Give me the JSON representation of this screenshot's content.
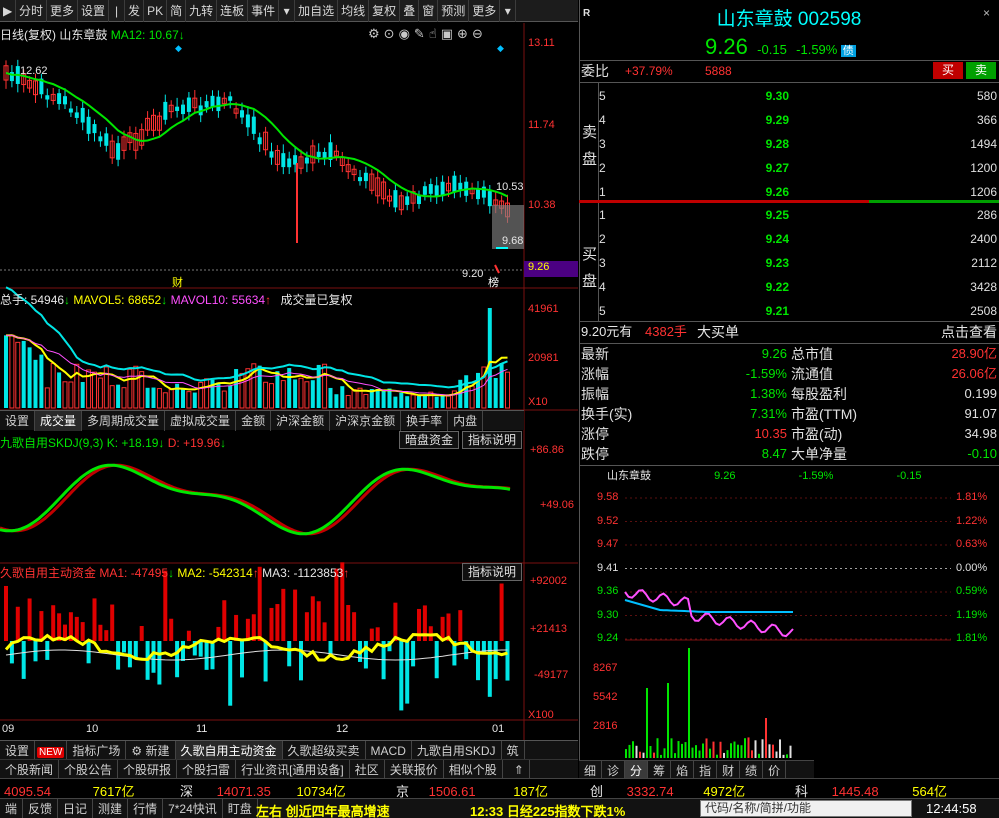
{
  "toolbar": [
    "分时",
    "更多",
    "设置",
    "发",
    "PK",
    "简",
    "九转",
    "连板",
    "事件",
    "加自选",
    "均线",
    "复权",
    "叠",
    "窗",
    "预测",
    "更多"
  ],
  "kline": {
    "title": "日线(复权)",
    "name": "山东章鼓",
    "ma_label": "MA12: 10.67",
    "axis": [
      "13.11",
      "11.74",
      "10.38",
      "9.26"
    ],
    "price_marks": [
      "12.62",
      "10.53",
      "9.68",
      "9.20"
    ],
    "tags": [
      "财",
      "榜"
    ]
  },
  "volume": {
    "label_total": "总手: 54946",
    "label_ma5": "MAVOL5: 68652",
    "label_ma10": "MAVOL10: 55634",
    "label_note": "成交量已复权",
    "axis": [
      "41961",
      "20981",
      "X10"
    ]
  },
  "mid_tabs": [
    "设置",
    "成交量",
    "多周期成交量",
    "虚拟成交量",
    "金额",
    "沪深金额",
    "沪深京金额",
    "换手率",
    "内盘"
  ],
  "skdj": {
    "label": "九歌自用SKDJ(9,3)",
    "k": "K: +18.19",
    "d": "D: +19.96",
    "btn1": "暗盘资金",
    "btn2": "指标说明",
    "axis": [
      "+86.86",
      "+49.06"
    ]
  },
  "fund": {
    "label": "久歌自用主动资金",
    "ma1": "MA1: -47495",
    "ma2": "MA2: -542314",
    "ma3": "MA3: -1123853",
    "btn": "指标说明",
    "axis": [
      "+92002",
      "+21413",
      "-49177",
      "X100"
    ],
    "months": [
      "09",
      "10",
      "11",
      "12",
      "01"
    ]
  },
  "bottom_tabs": [
    "设置",
    "NEW",
    "指标广场",
    "新建",
    "久歌自用主动资金",
    "久歌超级买卖",
    "MACD",
    "九歌自用SKDJ",
    "筑"
  ],
  "news_tabs": [
    "个股新闻",
    "个股公告",
    "个股研报",
    "个股扫雷",
    "行业资讯[通用设备]",
    "社区",
    "关联报价",
    "相似个股"
  ],
  "quote": {
    "r": "R",
    "title": "山东章鼓 002598",
    "price": "9.26",
    "change": "-0.15",
    "pct": "-1.59%",
    "badge": "债",
    "weibi_label": "委比",
    "weibi_val": "+37.79%",
    "weibi_diff": "5888",
    "buy_btn": "买",
    "sell_btn": "卖",
    "sell_side": "卖盘",
    "buy_side": "买盘",
    "asks": [
      {
        "lvl": "5",
        "price": "9.30",
        "vol": "580"
      },
      {
        "lvl": "4",
        "price": "9.29",
        "vol": "366"
      },
      {
        "lvl": "3",
        "price": "9.28",
        "vol": "1494"
      },
      {
        "lvl": "2",
        "price": "9.27",
        "vol": "1200"
      },
      {
        "lvl": "1",
        "price": "9.26",
        "vol": "1206"
      }
    ],
    "bids": [
      {
        "lvl": "1",
        "price": "9.25",
        "vol": "286"
      },
      {
        "lvl": "2",
        "price": "9.24",
        "vol": "2400"
      },
      {
        "lvl": "3",
        "price": "9.23",
        "vol": "2112"
      },
      {
        "lvl": "4",
        "price": "9.22",
        "vol": "3428"
      },
      {
        "lvl": "5",
        "price": "9.21",
        "vol": "2508"
      }
    ],
    "bigorder": {
      "price": "9.20元有",
      "vol": "4382手",
      "text": "大买单",
      "link": "点击查看"
    },
    "stats": [
      {
        "l": "最新",
        "v": "9.26",
        "l2": "总市值",
        "v2": "28.90亿"
      },
      {
        "l": "涨幅",
        "v": "-1.59%",
        "l2": "流通值",
        "v2": "26.06亿"
      },
      {
        "l": "振幅",
        "v": "1.38%",
        "l2": "每股盈利",
        "v2": "0.199"
      },
      {
        "l": "换手(实)",
        "v": "7.31%",
        "l2": "市盈(TTM)",
        "v2": "91.07"
      },
      {
        "l": "涨停",
        "v": "10.35",
        "l2": "市盈(动)",
        "v2": "34.98"
      },
      {
        "l": "跌停",
        "v": "8.47",
        "l2": "大单净量",
        "v2": "-0.10"
      }
    ]
  },
  "intraday": {
    "name": "山东章鼓",
    "price": "9.26",
    "pct": "-1.59%",
    "chg": "-0.15",
    "left_axis": [
      "9.58",
      "9.52",
      "9.47",
      "9.41",
      "9.36",
      "9.30",
      "9.24"
    ],
    "right_axis": [
      "1.81%",
      "1.22%",
      "0.63%",
      "0.00%",
      "0.59%",
      "1.19%",
      "1.81%"
    ],
    "vol_axis": [
      "8267",
      "5542",
      "2816"
    ]
  },
  "side_tabs": [
    "细",
    "诊",
    "分",
    "筹",
    "焰",
    "指",
    "财",
    "绩",
    "价"
  ],
  "status": {
    "sh_val": "4095.54",
    "sh_amt": "7617亿",
    "sz_label": "深",
    "sz_val": "14071.35",
    "sz_amt": "10734亿",
    "bj_label": "京",
    "bj_val": "1506.61",
    "bj_amt": "187亿",
    "cy_label": "创",
    "cy_val": "3332.74",
    "cy_amt": "4972亿",
    "kc_label": "科",
    "kc_val": "1445.48",
    "kc_amt": "564亿"
  },
  "bottom": {
    "items": [
      "端",
      "反馈",
      "日记",
      "测建",
      "行情",
      "7*24快讯",
      "盯盘"
    ],
    "news1": "左右 创近四年最高增速",
    "news2": "12:33 日经225指数下跌1%",
    "search": "代码/名称/简拼/功能",
    "time": "12:44:58"
  }
}
